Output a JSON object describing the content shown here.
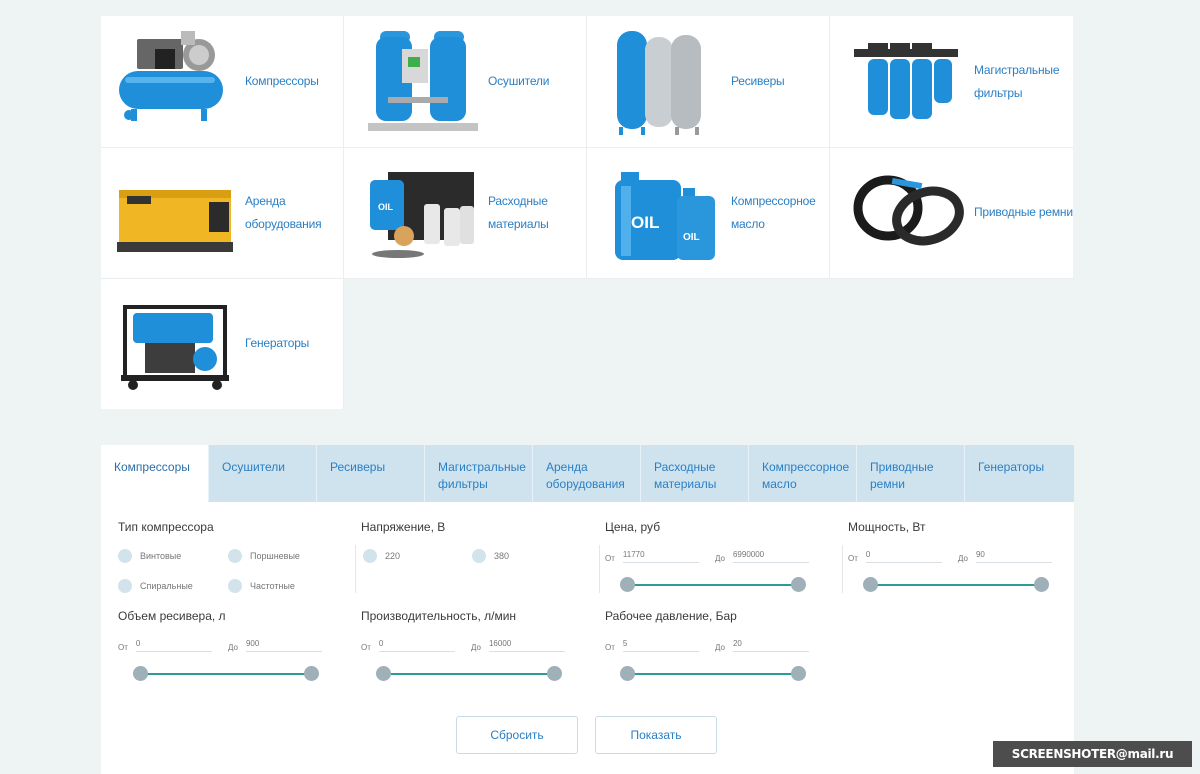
{
  "categories": [
    {
      "label": "Компрессоры",
      "icon": "air-compressor-image"
    },
    {
      "label": "Осушители",
      "icon": "air-dryer-image"
    },
    {
      "label": "Ресиверы",
      "icon": "receiver-tanks-image"
    },
    {
      "label": "Магистральные фильтры",
      "icon": "line-filters-image"
    },
    {
      "label": "Аренда оборудования",
      "icon": "rental-generator-image"
    },
    {
      "label": "Расходные материалы",
      "icon": "consumables-image"
    },
    {
      "label": "Компрессорное масло",
      "icon": "oil-canisters-image"
    },
    {
      "label": "Приводные ремни",
      "icon": "drive-belts-image"
    },
    {
      "label": "Генераторы",
      "icon": "generator-image"
    }
  ],
  "tabs": [
    "Компрессоры",
    "Осушители",
    "Ресиверы",
    "Магистральные фильтры",
    "Аренда оборудования",
    "Расходные материалы",
    "Компрессорное масло",
    "Приводные ремни",
    "Генераторы"
  ],
  "active_tab": "Компрессоры",
  "filters": {
    "type": {
      "title": "Тип компрессора",
      "options": [
        "Винтовые",
        "Поршневые",
        "Спиральные",
        "Частотные"
      ]
    },
    "voltage": {
      "title": "Напряжение, В",
      "options": [
        "220",
        "380"
      ]
    },
    "price": {
      "title": "Цена, руб",
      "from_label": "От",
      "from": "11770",
      "to_label": "До",
      "to": "6990000"
    },
    "power": {
      "title": "Мощность, Вт",
      "from_label": "От",
      "from": "0",
      "to_label": "До",
      "to": "90"
    },
    "volume": {
      "title": "Объем ресивера, л",
      "from_label": "От",
      "from": "0",
      "to_label": "До",
      "to": "900"
    },
    "capacity": {
      "title": "Производительность, л/мин",
      "from_label": "От",
      "from": "0",
      "to_label": "До",
      "to": "16000"
    },
    "pressure": {
      "title": "Рабочее давление, Бар",
      "from_label": "От",
      "from": "5",
      "to_label": "До",
      "to": "20"
    }
  },
  "buttons": {
    "reset": "Сбросить",
    "show": "Показать"
  },
  "watermark": "SCREENSHOTER@mail.ru",
  "colors": {
    "accent": "#2a7fc4",
    "tab_bg": "#cfe3ef",
    "slider": "#2e9c94",
    "knob": "#9fb0b8"
  }
}
